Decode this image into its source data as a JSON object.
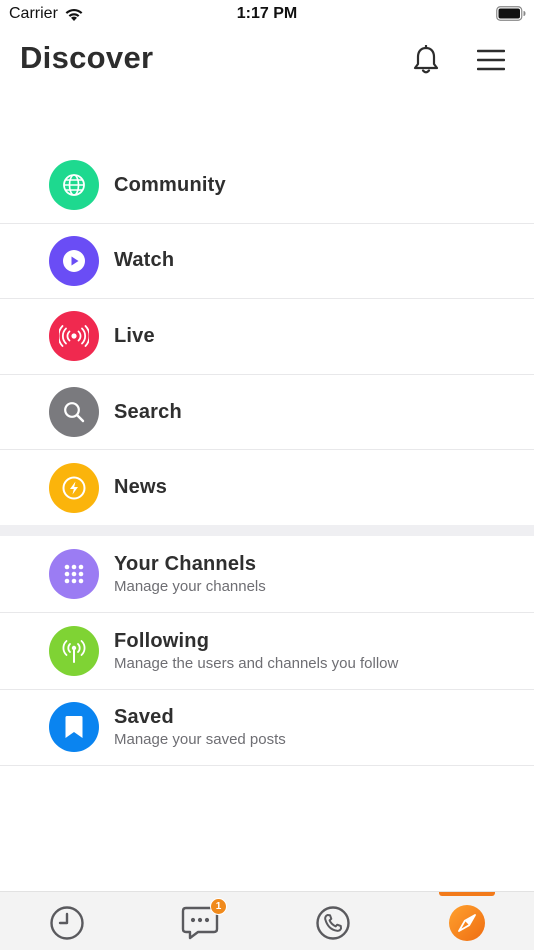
{
  "status_bar": {
    "carrier": "Carrier",
    "time": "1:17 PM"
  },
  "header": {
    "title": "Discover",
    "bell_icon": "bell-icon",
    "menu_icon": "hamburger-menu-icon"
  },
  "primary_items": [
    {
      "label": "Community",
      "icon": "globe-icon",
      "color": "#1ed98f"
    },
    {
      "label": "Watch",
      "icon": "play-icon",
      "color": "#6a4df5"
    },
    {
      "label": "Live",
      "icon": "broadcast-icon",
      "color": "#f0294f"
    },
    {
      "label": "Search",
      "icon": "search-icon",
      "color": "#7a7a7e"
    },
    {
      "label": "News",
      "icon": "lightning-icon",
      "color": "#fbb40b"
    }
  ],
  "secondary_items": [
    {
      "label": "Your Channels",
      "subtitle": "Manage your channels",
      "icon": "grid-dots-icon",
      "color": "#9b7cf3"
    },
    {
      "label": "Following",
      "subtitle": "Manage the users and channels you follow",
      "icon": "antenna-icon",
      "color": "#7fd334"
    },
    {
      "label": "Saved",
      "subtitle": "Manage your saved posts",
      "icon": "bookmark-icon",
      "color": "#0a84f0"
    }
  ],
  "tab_bar": {
    "tabs": [
      {
        "name": "recent",
        "icon": "clock-icon"
      },
      {
        "name": "chats",
        "icon": "chat-bubble-icon",
        "badge": "1"
      },
      {
        "name": "calls",
        "icon": "phone-icon"
      },
      {
        "name": "discover",
        "icon": "compass-icon",
        "active": true
      }
    ],
    "accent_color": "#f27a1a"
  }
}
